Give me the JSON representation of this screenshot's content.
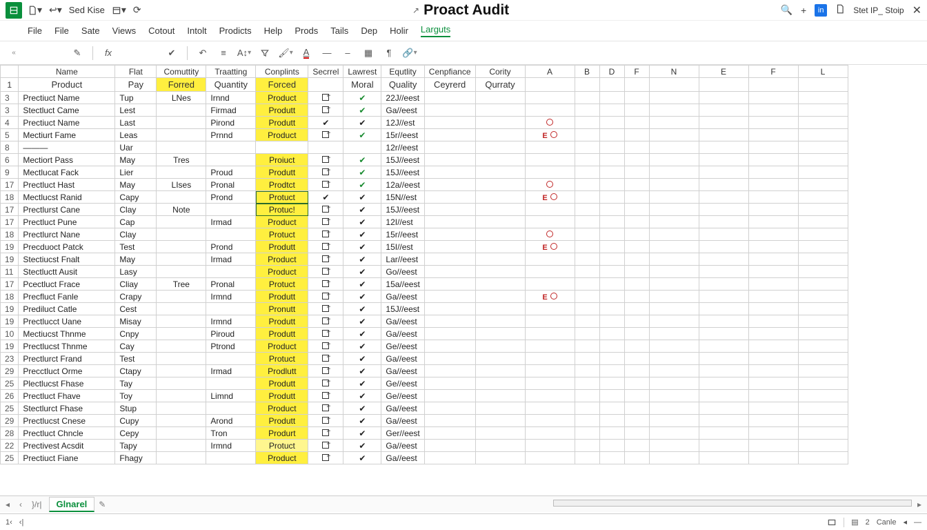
{
  "titlebar": {
    "quick_label": "Sed Kise",
    "doc_title": "Proact Audit",
    "right_label": "Stet IP_ Stoip"
  },
  "menubar": {
    "items": [
      "File",
      "File",
      "Sate",
      "Views",
      "Cotout",
      "Intolt",
      "Prodicts",
      "Help",
      "Prods",
      "Tails",
      "Dep",
      "Holir",
      "Larguts"
    ]
  },
  "columns": {
    "letters": [
      "A",
      "B",
      "D",
      "F",
      "N",
      "E",
      "F",
      "L"
    ],
    "hdr1": [
      "Name",
      "Flat",
      "Comuttity",
      "Traatting",
      "Conplints",
      "Secrrel",
      "Lawrest",
      "Equtlity",
      "Cenpfiance",
      "Cority"
    ],
    "hdr2": [
      "Product",
      "Pay",
      "Forred",
      "Quantity",
      "Forced",
      "",
      "Moral",
      "Quality",
      "Ceyrerd",
      "Qurraty"
    ],
    "widths": [
      26,
      140,
      60,
      72,
      72,
      76,
      48,
      54,
      58,
      72,
      72,
      72,
      36,
      36,
      36,
      72,
      72,
      72,
      72,
      36
    ]
  },
  "rows": [
    {
      "n": "3",
      "name": "Prectiuct Name",
      "pay": "Tup",
      "com": "LNes",
      "qty": "Irnnd",
      "forced": "Product",
      "c1": "o",
      "c2": "g",
      "qual": "22J//eest",
      "flag": "",
      "circle": false
    },
    {
      "n": "3",
      "name": "Stectluct Came",
      "pay": "Lest",
      "com": "",
      "qty": "Firmad",
      "forced": "Produtt",
      "c1": "o",
      "c2": "g",
      "qual": "Ga//eest",
      "flag": "",
      "circle": false
    },
    {
      "n": "4",
      "name": "Prectiuct Name",
      "pay": "Last",
      "com": "",
      "qty": "Pirond",
      "forced": "Produtt",
      "c1": "b",
      "c2": "b",
      "qual": "12J//est",
      "flag": "",
      "circle": true
    },
    {
      "n": "5",
      "name": "Mectiurt Fame",
      "pay": "Leas",
      "com": "",
      "qty": "Prnnd",
      "forced": "Product",
      "c1": "o",
      "c2": "g",
      "qual": "15r//eest",
      "flag": "E",
      "circle": true
    },
    {
      "n": "8",
      "name": "———",
      "pay": "Uar",
      "com": "",
      "qty": "",
      "forced": "",
      "c1": "",
      "c2": "",
      "qual": "12r//eest",
      "flag": "",
      "circle": false
    },
    {
      "n": "6",
      "name": "Mectiort Pass",
      "pay": "May",
      "com": "Tres",
      "qty": "",
      "forced": "Proiuct",
      "c1": "o",
      "c2": "g",
      "qual": "15J//eest",
      "flag": "",
      "circle": false
    },
    {
      "n": "9",
      "name": "Mectlucat Fack",
      "pay": "Lier",
      "com": "",
      "qty": "Proud",
      "forced": "Produtt",
      "c1": "o",
      "c2": "g",
      "qual": "15J//eest",
      "flag": "",
      "circle": false
    },
    {
      "n": "17",
      "name": "Prectluct Hast",
      "pay": "May",
      "com": "LIses",
      "qty": "Pronal",
      "forced": "Prodtct",
      "c1": "o",
      "c2": "g",
      "qual": "12a//eest",
      "flag": "",
      "circle": true
    },
    {
      "n": "18",
      "name": "Mectlucst Ranid",
      "pay": "Capy",
      "com": "",
      "qty": "Prond",
      "forced": "Protuct",
      "c1": "b",
      "c2": "b",
      "qual": "15N//est",
      "flag": "E",
      "circle": true,
      "box": true
    },
    {
      "n": "17",
      "name": "Prectlurst Cane",
      "pay": "Clay",
      "com": "Note",
      "qty": "",
      "forced": "Protuc!",
      "c1": "o",
      "c2": "b",
      "qual": "15J//eest",
      "flag": "",
      "circle": false,
      "box": true
    },
    {
      "n": "17",
      "name": "Prectluct Pune",
      "pay": "Cap",
      "com": "",
      "qty": "Irmad",
      "forced": "Product",
      "c1": "o",
      "c2": "b",
      "qual": "12I//est",
      "flag": "",
      "circle": false
    },
    {
      "n": "18",
      "name": "Prectlurct Nane",
      "pay": "Clay",
      "com": "",
      "qty": "",
      "forced": "Protuct",
      "c1": "o",
      "c2": "b",
      "qual": "15r//eest",
      "flag": "",
      "circle": true
    },
    {
      "n": "19",
      "name": "Precduoct Patck",
      "pay": "Test",
      "com": "",
      "qty": "Prond",
      "forced": "Produtt",
      "c1": "o",
      "c2": "b",
      "qual": "15I//est",
      "flag": "E",
      "circle": true
    },
    {
      "n": "19",
      "name": "Stectiucst Fnalt",
      "pay": "May",
      "com": "",
      "qty": "Irmad",
      "forced": "Product",
      "c1": "o",
      "c2": "b",
      "qual": "Lar//eest",
      "flag": "",
      "circle": false
    },
    {
      "n": "11",
      "name": "Stectluctt Ausit",
      "pay": "Lasy",
      "com": "",
      "qty": "",
      "forced": "Product",
      "c1": "o",
      "c2": "b",
      "qual": "Go//eest",
      "flag": "",
      "circle": false
    },
    {
      "n": "17",
      "name": "Pcectluct Frace",
      "pay": "Cliay",
      "com": "Tree",
      "qty": "Pronal",
      "forced": "Protuct",
      "c1": "o",
      "c2": "b",
      "qual": "15a//eest",
      "flag": "",
      "circle": false
    },
    {
      "n": "18",
      "name": "Precfluct Fanle",
      "pay": "Crapy",
      "com": "",
      "qty": "Irmnd",
      "forced": "Produtt",
      "c1": "o",
      "c2": "b",
      "qual": "Ga//eest",
      "flag": "E",
      "circle": true
    },
    {
      "n": "19",
      "name": "Prediluct Catle",
      "pay": "Cest",
      "com": "",
      "qty": "",
      "forced": "Pronutt",
      "c1": "o",
      "c2": "b",
      "qual": "15J//eest",
      "flag": "",
      "circle": false
    },
    {
      "n": "19",
      "name": "Prectlucct Uane",
      "pay": "Misay",
      "com": "",
      "qty": "Irmnd",
      "forced": "Produtt",
      "c1": "o",
      "c2": "b",
      "qual": "Ga//eest",
      "flag": "",
      "circle": false
    },
    {
      "n": "10",
      "name": "Mectiucst Thnme",
      "pay": "Cnpy",
      "com": "",
      "qty": "Piroud",
      "forced": "Produtt",
      "c1": "o",
      "c2": "b",
      "qual": "Ga//eest",
      "flag": "",
      "circle": false
    },
    {
      "n": "19",
      "name": "Prectlucst Thnme",
      "pay": "Cay",
      "com": "",
      "qty": "Ptrond",
      "forced": "Product",
      "c1": "o",
      "c2": "b",
      "qual": "Ge//eest",
      "flag": "",
      "circle": false
    },
    {
      "n": "23",
      "name": "Prectlurct Frand",
      "pay": "Test",
      "com": "",
      "qty": "",
      "forced": "Protuct",
      "c1": "o",
      "c2": "b",
      "qual": "Ga//eest",
      "flag": "",
      "circle": false
    },
    {
      "n": "29",
      "name": "Precctluct Orme",
      "pay": "Ctapy",
      "com": "",
      "qty": "Irmad",
      "forced": "Prodlutt",
      "c1": "o",
      "c2": "b",
      "qual": "Ga//eest",
      "flag": "",
      "circle": false
    },
    {
      "n": "25",
      "name": "Plectlucst Fhase",
      "pay": "Tay",
      "com": "",
      "qty": "",
      "forced": "Produtt",
      "c1": "o",
      "c2": "b",
      "qual": "Ge//eest",
      "flag": "",
      "circle": false
    },
    {
      "n": "26",
      "name": "Prectluct Fhave",
      "pay": "Toy",
      "com": "",
      "qty": "Limnd",
      "forced": "Produtt",
      "c1": "o",
      "c2": "b",
      "qual": "Ge//eest",
      "flag": "",
      "circle": false
    },
    {
      "n": "25",
      "name": "Stectlurct Fhase",
      "pay": "Stup",
      "com": "",
      "qty": "",
      "forced": "Product",
      "c1": "o",
      "c2": "b",
      "qual": "Ga//eest",
      "flag": "",
      "circle": false
    },
    {
      "n": "29",
      "name": "Prectlucst Cnese",
      "pay": "Cupy",
      "com": "",
      "qty": "Arond",
      "forced": "Produtt",
      "c1": "o",
      "c2": "b",
      "qual": "Ga//eest",
      "flag": "",
      "circle": false
    },
    {
      "n": "28",
      "name": "Prectluct Chncle",
      "pay": "Cepy",
      "com": "",
      "qty": "Tron",
      "forced": "Produrt",
      "c1": "o",
      "c2": "b",
      "qual": "Ger//eest",
      "flag": "",
      "circle": false
    },
    {
      "n": "22",
      "name": "Prectivest Acsdit",
      "pay": "Tapy",
      "com": "",
      "qty": "Irmnd",
      "forced": "Protuct",
      "c1": "o",
      "c2": "b",
      "qual": "Ga//eest",
      "flag": "",
      "circle": false,
      "light": true
    },
    {
      "n": "25",
      "name": "Prectiuct Fiane",
      "pay": "Fhagy",
      "com": "",
      "qty": "",
      "forced": "Product",
      "c1": "o",
      "c2": "b",
      "qual": "Ga//eest",
      "flag": "",
      "circle": false
    }
  ],
  "tabs": {
    "main_hint": "}/r|",
    "active": "Glnarel"
  },
  "statusbar": {
    "zoom_label": "Canle",
    "zoom_digit": "2"
  }
}
